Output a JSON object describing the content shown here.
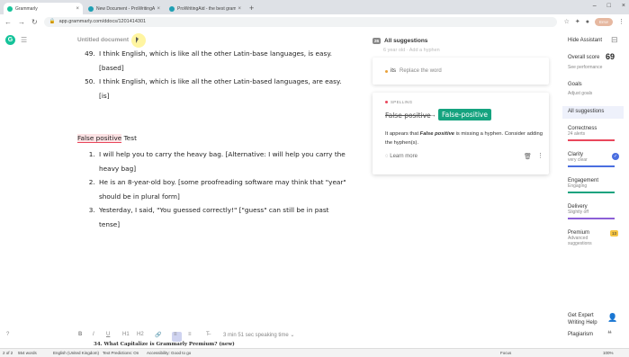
{
  "browser": {
    "tabs": [
      {
        "label": "Grammarly",
        "color": "#15c39a",
        "active": true
      },
      {
        "label": "New Document - ProWritingAid",
        "color": "#1e9fb3",
        "active": false
      },
      {
        "label": "ProWritingAid - the best gramm...",
        "color": "#1e9fb3",
        "active": false
      }
    ],
    "new_tab": "+",
    "url": "app.grammarly.com/ddocs/1201414301",
    "profile": "Error"
  },
  "app": {
    "doc_title": "Untitled document",
    "list1": [
      {
        "num": "49.",
        "text": "I think English, which is like all the other Latin-base languages, is easy. [based]"
      },
      {
        "num": "50.",
        "text": "I think English, which is like all the other Latin-based languages, are easy. [is]"
      }
    ],
    "heading_highlight": "False positive",
    "heading_rest": " Test",
    "list2": [
      "I will help you to carry the heavy bag. [Alternative: I will help you carry the heavy bag]",
      "He is an 8-year-old boy. [some proofreading software may think that \"year\" should be in plural form]",
      "Yesterday, I said, \"You guessed correctly!\" [\"guess\" can still be in past tense]"
    ],
    "toolbar": {
      "bold": "B",
      "italic": "I",
      "underline": "U",
      "h1": "H1",
      "h2": "H2",
      "link": "🔗",
      "ol": "≡",
      "ul": "≡",
      "clear": "T̶",
      "speaking_time": "3 min 51 sec speaking time ⌄"
    },
    "partial_text": "34. What Capitalize is Grammarly Premium? (new)"
  },
  "suggestions": {
    "count": "26",
    "title": "All suggestions",
    "faded": "6 year old · Add a hyphen",
    "card1": {
      "word": "its",
      "action": "Replace the word"
    },
    "card2": {
      "category": "SPELLING",
      "old": "False positive",
      "new": "False-positive",
      "expl_pre": "It appears that ",
      "expl_term": "False positive",
      "expl_post": " is missing a hyphen. Consider adding the hyphen(s).",
      "learn_more": "Learn more"
    }
  },
  "sidebar": {
    "hide": "Hide Assistant",
    "overall": "Overall score",
    "score": "69",
    "see_perf": "See performance",
    "goals": "Goals",
    "adjust_goals": "Adjust goals",
    "all_suggestions": "All suggestions",
    "categories": [
      {
        "name": "Correctness",
        "sub": "24 alerts",
        "color": "#e9475c"
      },
      {
        "name": "Clarity",
        "sub": "very clear",
        "color": "#4a6ee0"
      },
      {
        "name": "Engagement",
        "sub": "Engaging",
        "color": "#15a37f"
      },
      {
        "name": "Delivery",
        "sub": "Slightly off",
        "color": "#8c5fd6"
      },
      {
        "name": "Premium",
        "sub": "Advanced suggestions",
        "color": "#f6c543",
        "badge": "13"
      }
    ],
    "expert": "Get Expert Writing Help",
    "plagiarism": "Plagiarism"
  },
  "status": {
    "page": "2 of 2",
    "words": "554 words",
    "language": "English (United Kingdom)",
    "predictions": "Text Predictions: On",
    "accessibility": "Accessibility: Good to go",
    "focus": "Focus",
    "zoom": "100%"
  }
}
